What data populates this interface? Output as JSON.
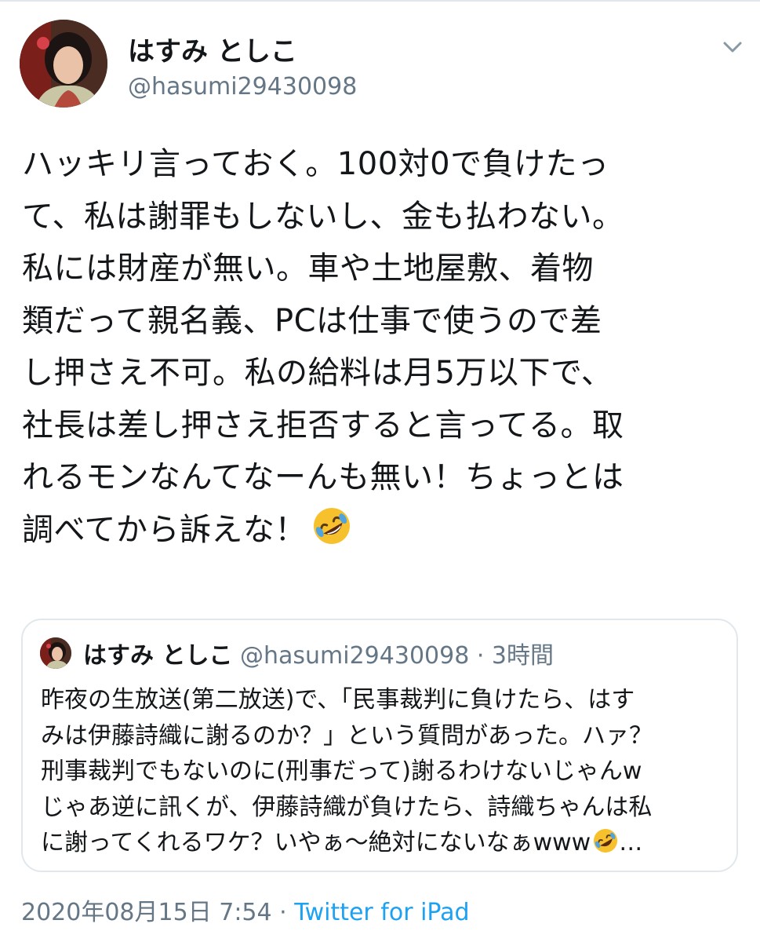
{
  "tweet": {
    "display_name": "はすみ としこ",
    "handle": "@hasumi29430098",
    "text_lines": [
      "ハッキリ言っておく。100対0で負けたっ",
      "て、私は謝罪もしないし、金も払わない。",
      "私には財産が無い。車や土地屋敷、着物",
      "類だって親名義、PCは仕事で使うので差",
      "し押さえ不可。私の給料は月5万以下で、",
      "社長は差し押さえ拒否すると言ってる。取",
      "れるモンなんてなーんも無い！ちょっとは",
      "調べてから訴えな！"
    ],
    "emoji": "rolling-on-floor-laughing-emoji",
    "date": "2020年08月15日 7:54",
    "separator": " · ",
    "source": "Twitter for iPad"
  },
  "quoted_tweet": {
    "display_name": "はすみ としこ",
    "handle": "@hasumi29430098",
    "time": "· 3時間",
    "text_lines": [
      "昨夜の生放送(第二放送)で、「民事裁判に負けたら、はす",
      "みは伊藤詩織に謝るのか？」という質問があった。ハァ？",
      "刑事裁判でもないのに(刑事だって)謝るわけないじゃんw",
      "じゃあ逆に訊くが、伊藤詩織が負けたら、詩織ちゃんは私",
      "に謝ってくれるワケ？いやぁ～絶対にないなぁwww"
    ],
    "ellipsis": "…"
  },
  "colors": {
    "text": "#14171a",
    "secondary": "#657786",
    "link": "#1da1f2",
    "border": "#e1e8ed"
  }
}
